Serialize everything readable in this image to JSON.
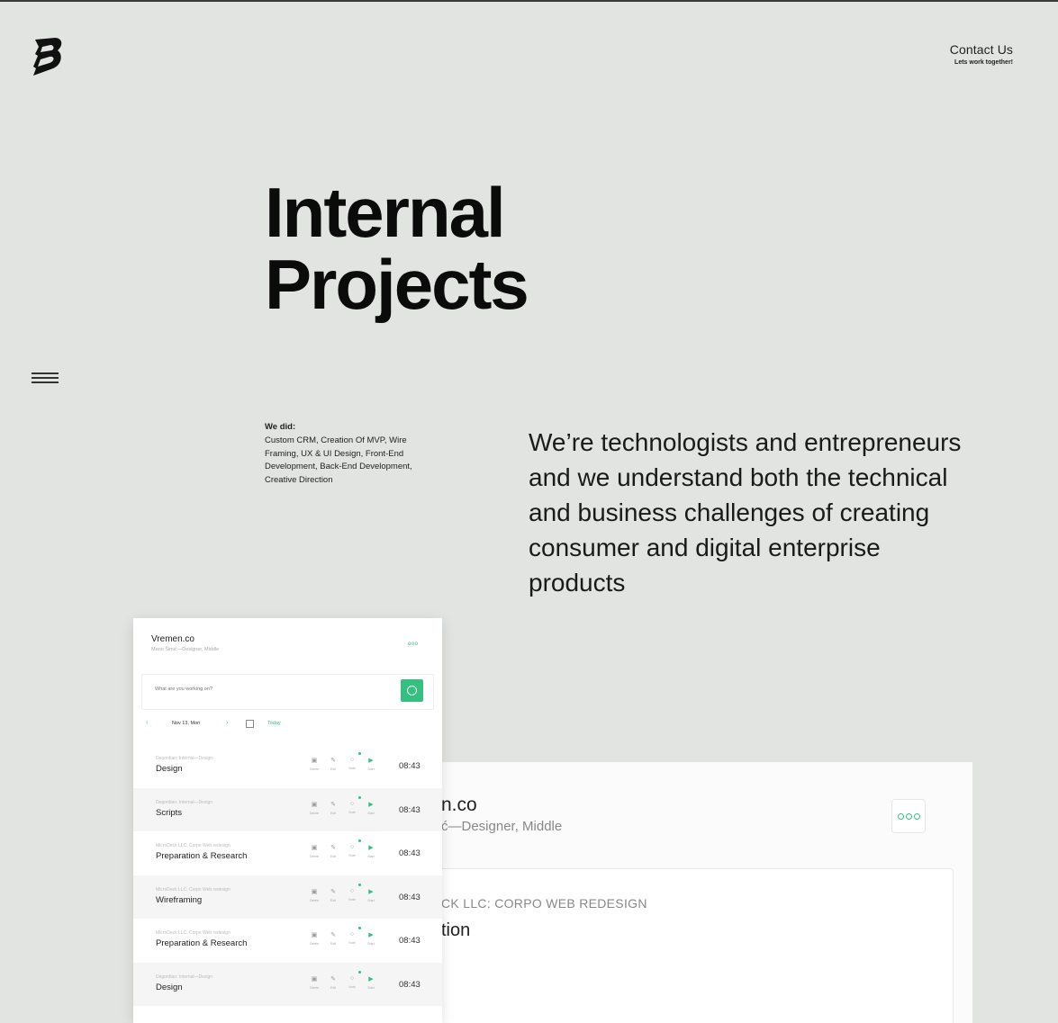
{
  "header": {
    "logo_name": "b-logo-icon",
    "contact_title": "Contact Us",
    "contact_sub": "Lets work together!"
  },
  "hero": {
    "title_line1": "Internal",
    "title_line2": "Projects"
  },
  "we_did": {
    "label": "We did:",
    "text": "Custom CRM, Creation Of MVP, Wire Framing, UX & UI Design, Front-End Development, Back-End Development, Creative Direction"
  },
  "lead": "We’re technologists and entrepreneurs and we understand both the technical and business challenges of creating consumer and digital enterprise products",
  "app": {
    "title": "Vremen.co",
    "subtitle": "Mario Šimić—Designer, Middle",
    "menu_dots": "ooo",
    "search_placeholder": "What are you working on?",
    "prev": "‹",
    "next": "›",
    "date": "Nov 13, Mon",
    "today": "Today",
    "action_labels": [
      "Delete",
      "Edit",
      "Note",
      "Start"
    ],
    "rows": [
      {
        "project": "Degordian: Internal—Design",
        "task": "Design",
        "time": "08:43"
      },
      {
        "project": "Degordian: Internal—Design",
        "task": "Scripts",
        "time": "08:43"
      },
      {
        "project": "MicroDeck LLC: Corpo Web redesign",
        "task": "Preparation & Research",
        "time": "08:43"
      },
      {
        "project": "MicroDeck LLC: Corpo Web redesign",
        "task": "Wireframing",
        "time": "08:43"
      },
      {
        "project": "MicroDeck LLC: Corpo Web redesign",
        "task": "Preparation & Research",
        "time": "08:43"
      },
      {
        "project": "Degordian: Internal—Design",
        "task": "Design",
        "time": "08:43"
      }
    ]
  },
  "bigcard": {
    "title": "n.co",
    "subtitle": "ć—Designer, Middle",
    "project": "CK LLC: CORPO WEB REDESIGN",
    "task": "tion"
  },
  "colors": {
    "accent": "#34c17f",
    "background": "#e1e4e0"
  }
}
